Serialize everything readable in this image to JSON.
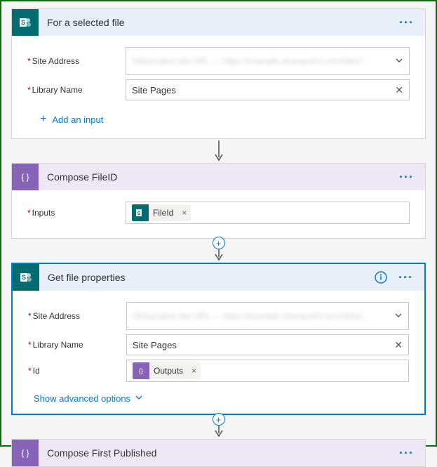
{
  "steps": {
    "selectedFile": {
      "title": "For a selected file",
      "fields": {
        "siteAddressLabel": "Site Address",
        "siteAddressPlaceholder": "Obfuscated site URL — https://example.sharepoint.com/sites/...",
        "libraryLabel": "Library Name",
        "libraryValue": "Site Pages"
      },
      "addInput": "Add an input"
    },
    "composeFileId": {
      "title": "Compose FileID",
      "inputsLabel": "Inputs",
      "token": "FileId"
    },
    "getFileProps": {
      "title": "Get file properties",
      "fields": {
        "siteAddressLabel": "Site Address",
        "siteAddressPlaceholder": "Obfuscated site URL — https://example.sharepoint.com/sites/...",
        "libraryLabel": "Library Name",
        "libraryValue": "Site Pages",
        "idLabel": "Id",
        "idToken": "Outputs"
      },
      "advanced": "Show advanced options"
    },
    "composeFirstPublished": {
      "title": "Compose First Published"
    }
  }
}
